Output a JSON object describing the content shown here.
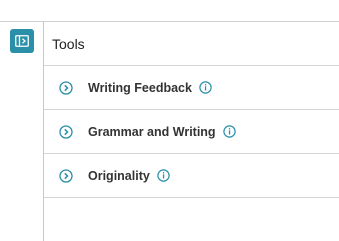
{
  "panel": {
    "title": "Tools",
    "toggle_icon": "panel-toggle-icon",
    "accent_color": "#2a8fa8"
  },
  "tools": [
    {
      "label": "Writing Feedback",
      "expand_icon": "chevron-right-circle-icon",
      "info_icon": "info-icon"
    },
    {
      "label": "Grammar and Writing",
      "expand_icon": "chevron-right-circle-icon",
      "info_icon": "info-icon"
    },
    {
      "label": "Originality",
      "expand_icon": "chevron-right-circle-icon",
      "info_icon": "info-icon"
    }
  ]
}
